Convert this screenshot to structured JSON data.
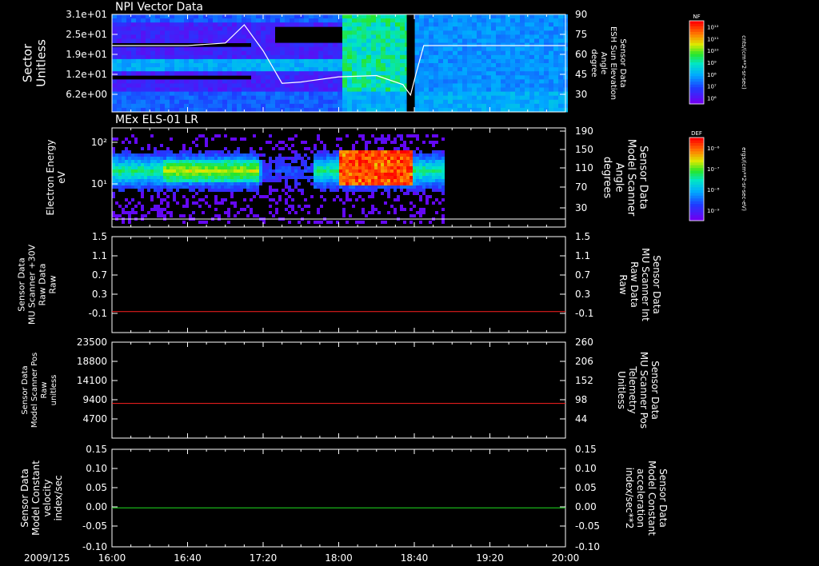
{
  "date_label": "2009/125",
  "x_ticks": [
    "16:00",
    "16:40",
    "17:20",
    "18:00",
    "18:40",
    "19:20",
    "20:00"
  ],
  "chart_data": [
    {
      "type": "heatmap",
      "title": "NPI Vector Data",
      "ylabel": [
        "Sector",
        "Unitless"
      ],
      "yticks": [
        "3.1e+01",
        "2.5e+01",
        "1.9e+01",
        "1.2e+01",
        "6.2e+00"
      ],
      "y2label": [
        "Sensor Data",
        "ESH Sun Elevation",
        "Angle",
        "degree"
      ],
      "y2ticks": [
        "90",
        "75",
        "60",
        "45",
        "30"
      ],
      "y2lim": [
        15,
        90
      ],
      "overlay_line": {
        "x": [
          "16:00",
          "16:40",
          "17:00",
          "17:10",
          "17:20",
          "17:30",
          "17:40",
          "18:00",
          "18:20",
          "18:34",
          "18:38",
          "18:41",
          "18:45",
          "19:20",
          "20:00"
        ],
        "y": [
          66,
          66,
          68,
          82,
          62,
          37,
          38,
          42,
          43,
          36,
          28,
          45,
          66,
          66,
          66
        ]
      },
      "colorbar": {
        "label": "NF",
        "units": "cnts/(cm**2-sr-sec)",
        "ticks": [
          "10¹²",
          "10¹¹",
          "10¹⁰",
          "10⁹",
          "10⁸",
          "10⁷",
          "10⁶"
        ]
      }
    },
    {
      "type": "heatmap",
      "title": "MEx ELS-01 LR",
      "ylabel": [
        "Electron Energy",
        "eV"
      ],
      "yticks": [
        "10²",
        "10¹"
      ],
      "y2label": [
        "Sensor Data",
        "Model Scanner",
        "Angle",
        "degrees"
      ],
      "y2ticks": [
        "190",
        "150",
        "110",
        "70",
        "30"
      ],
      "overlay_line": {
        "x": [
          "16:00",
          "20:00"
        ],
        "y": [
          15,
          15
        ]
      },
      "colorbar": {
        "label": "DEF",
        "units": "ergs/(cm**2-sr-sec-eV)",
        "ticks": [
          "10⁻⁶",
          "10⁻⁷",
          "10⁻⁸",
          "10⁻⁹"
        ]
      }
    },
    {
      "type": "line",
      "ylabel": [
        "Sensor Data",
        "MU Scanner +30V",
        "Raw Data",
        "Raw"
      ],
      "yticks": [
        "1.5",
        "1.1",
        "0.7",
        "0.3",
        "-0.1"
      ],
      "y2label": [
        "Sensor Data",
        "MU Scanner Int",
        "Raw Data",
        "Raw"
      ],
      "y2ticks": [
        "1.5",
        "1.1",
        "0.7",
        "0.3",
        "-0.1"
      ],
      "ylim": [
        -0.42,
        1.5
      ],
      "series": [
        {
          "x": [
            "16:00",
            "20:00"
          ],
          "y": [
            0.0,
            0.0
          ],
          "color": "#ff2020"
        }
      ]
    },
    {
      "type": "line",
      "ylabel": [
        "Sensor Data",
        "Model Scanner Pos",
        "Raw",
        "unitless"
      ],
      "yticks": [
        "23500",
        "18800",
        "14100",
        "9400",
        "4700"
      ],
      "y2label": [
        "Sensor Data",
        "MU Scanner Pos",
        "Telemetry",
        "Unitless"
      ],
      "y2ticks": [
        "260",
        "206",
        "152",
        "98",
        "44"
      ],
      "ylim": [
        0,
        23500
      ],
      "series": [
        {
          "x": [
            "16:00",
            "20:00"
          ],
          "y": [
            8500,
            8500
          ],
          "color": "#ff2020"
        }
      ]
    },
    {
      "type": "line",
      "ylabel": [
        "Sensor Data",
        "Model Constant",
        "velocity",
        "index/sec"
      ],
      "yticks": [
        "0.15",
        "0.10",
        "0.05",
        "0.00",
        "-0.05",
        "-0.10"
      ],
      "y2label": [
        "Sensor Data",
        "Model Constant",
        "acceleration",
        "index/sec**2"
      ],
      "y2ticks": [
        "0.15",
        "0.10",
        "0.05",
        "0.00",
        "-0.05",
        "-0.10"
      ],
      "ylim": [
        -0.1,
        0.15
      ],
      "series": [
        {
          "x": [
            "16:00",
            "20:00"
          ],
          "y": [
            0.0,
            0.0
          ],
          "color": "#20e020"
        }
      ]
    }
  ],
  "colors": {
    "left_label": "#ffffff",
    "red_label": "#ff2020",
    "green_label": "#20e020",
    "red_line": "#ff2020",
    "green_line": "#20e020"
  }
}
